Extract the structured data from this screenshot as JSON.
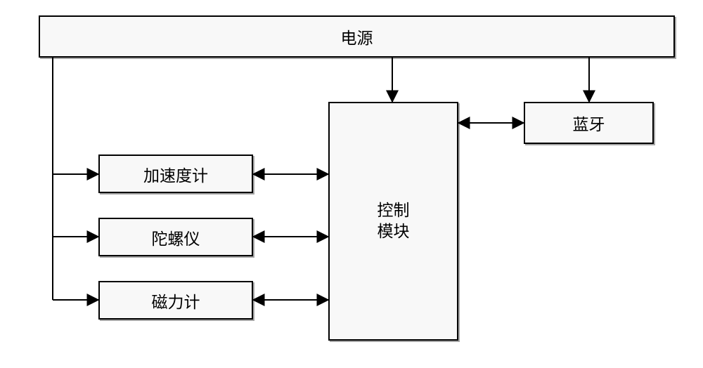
{
  "blocks": {
    "power": "电源",
    "accelerometer": "加速度计",
    "gyroscope": "陀螺仪",
    "magnetometer": "磁力计",
    "control": "控制\n模块",
    "bluetooth": "蓝牙"
  },
  "chart_data": {
    "type": "diagram",
    "title": "",
    "nodes": [
      {
        "id": "power",
        "label": "电源"
      },
      {
        "id": "accelerometer",
        "label": "加速度计"
      },
      {
        "id": "gyroscope",
        "label": "陀螺仪"
      },
      {
        "id": "magnetometer",
        "label": "磁力计"
      },
      {
        "id": "control",
        "label": "控制模块"
      },
      {
        "id": "bluetooth",
        "label": "蓝牙"
      }
    ],
    "edges": [
      {
        "from": "power",
        "to": "control",
        "arrow": "single"
      },
      {
        "from": "power",
        "to": "bluetooth",
        "arrow": "single"
      },
      {
        "from": "power",
        "to": "accelerometer",
        "arrow": "single"
      },
      {
        "from": "power",
        "to": "gyroscope",
        "arrow": "single"
      },
      {
        "from": "power",
        "to": "magnetometer",
        "arrow": "single"
      },
      {
        "from": "accelerometer",
        "to": "control",
        "arrow": "double"
      },
      {
        "from": "gyroscope",
        "to": "control",
        "arrow": "double"
      },
      {
        "from": "magnetometer",
        "to": "control",
        "arrow": "double"
      },
      {
        "from": "control",
        "to": "bluetooth",
        "arrow": "double"
      }
    ]
  }
}
